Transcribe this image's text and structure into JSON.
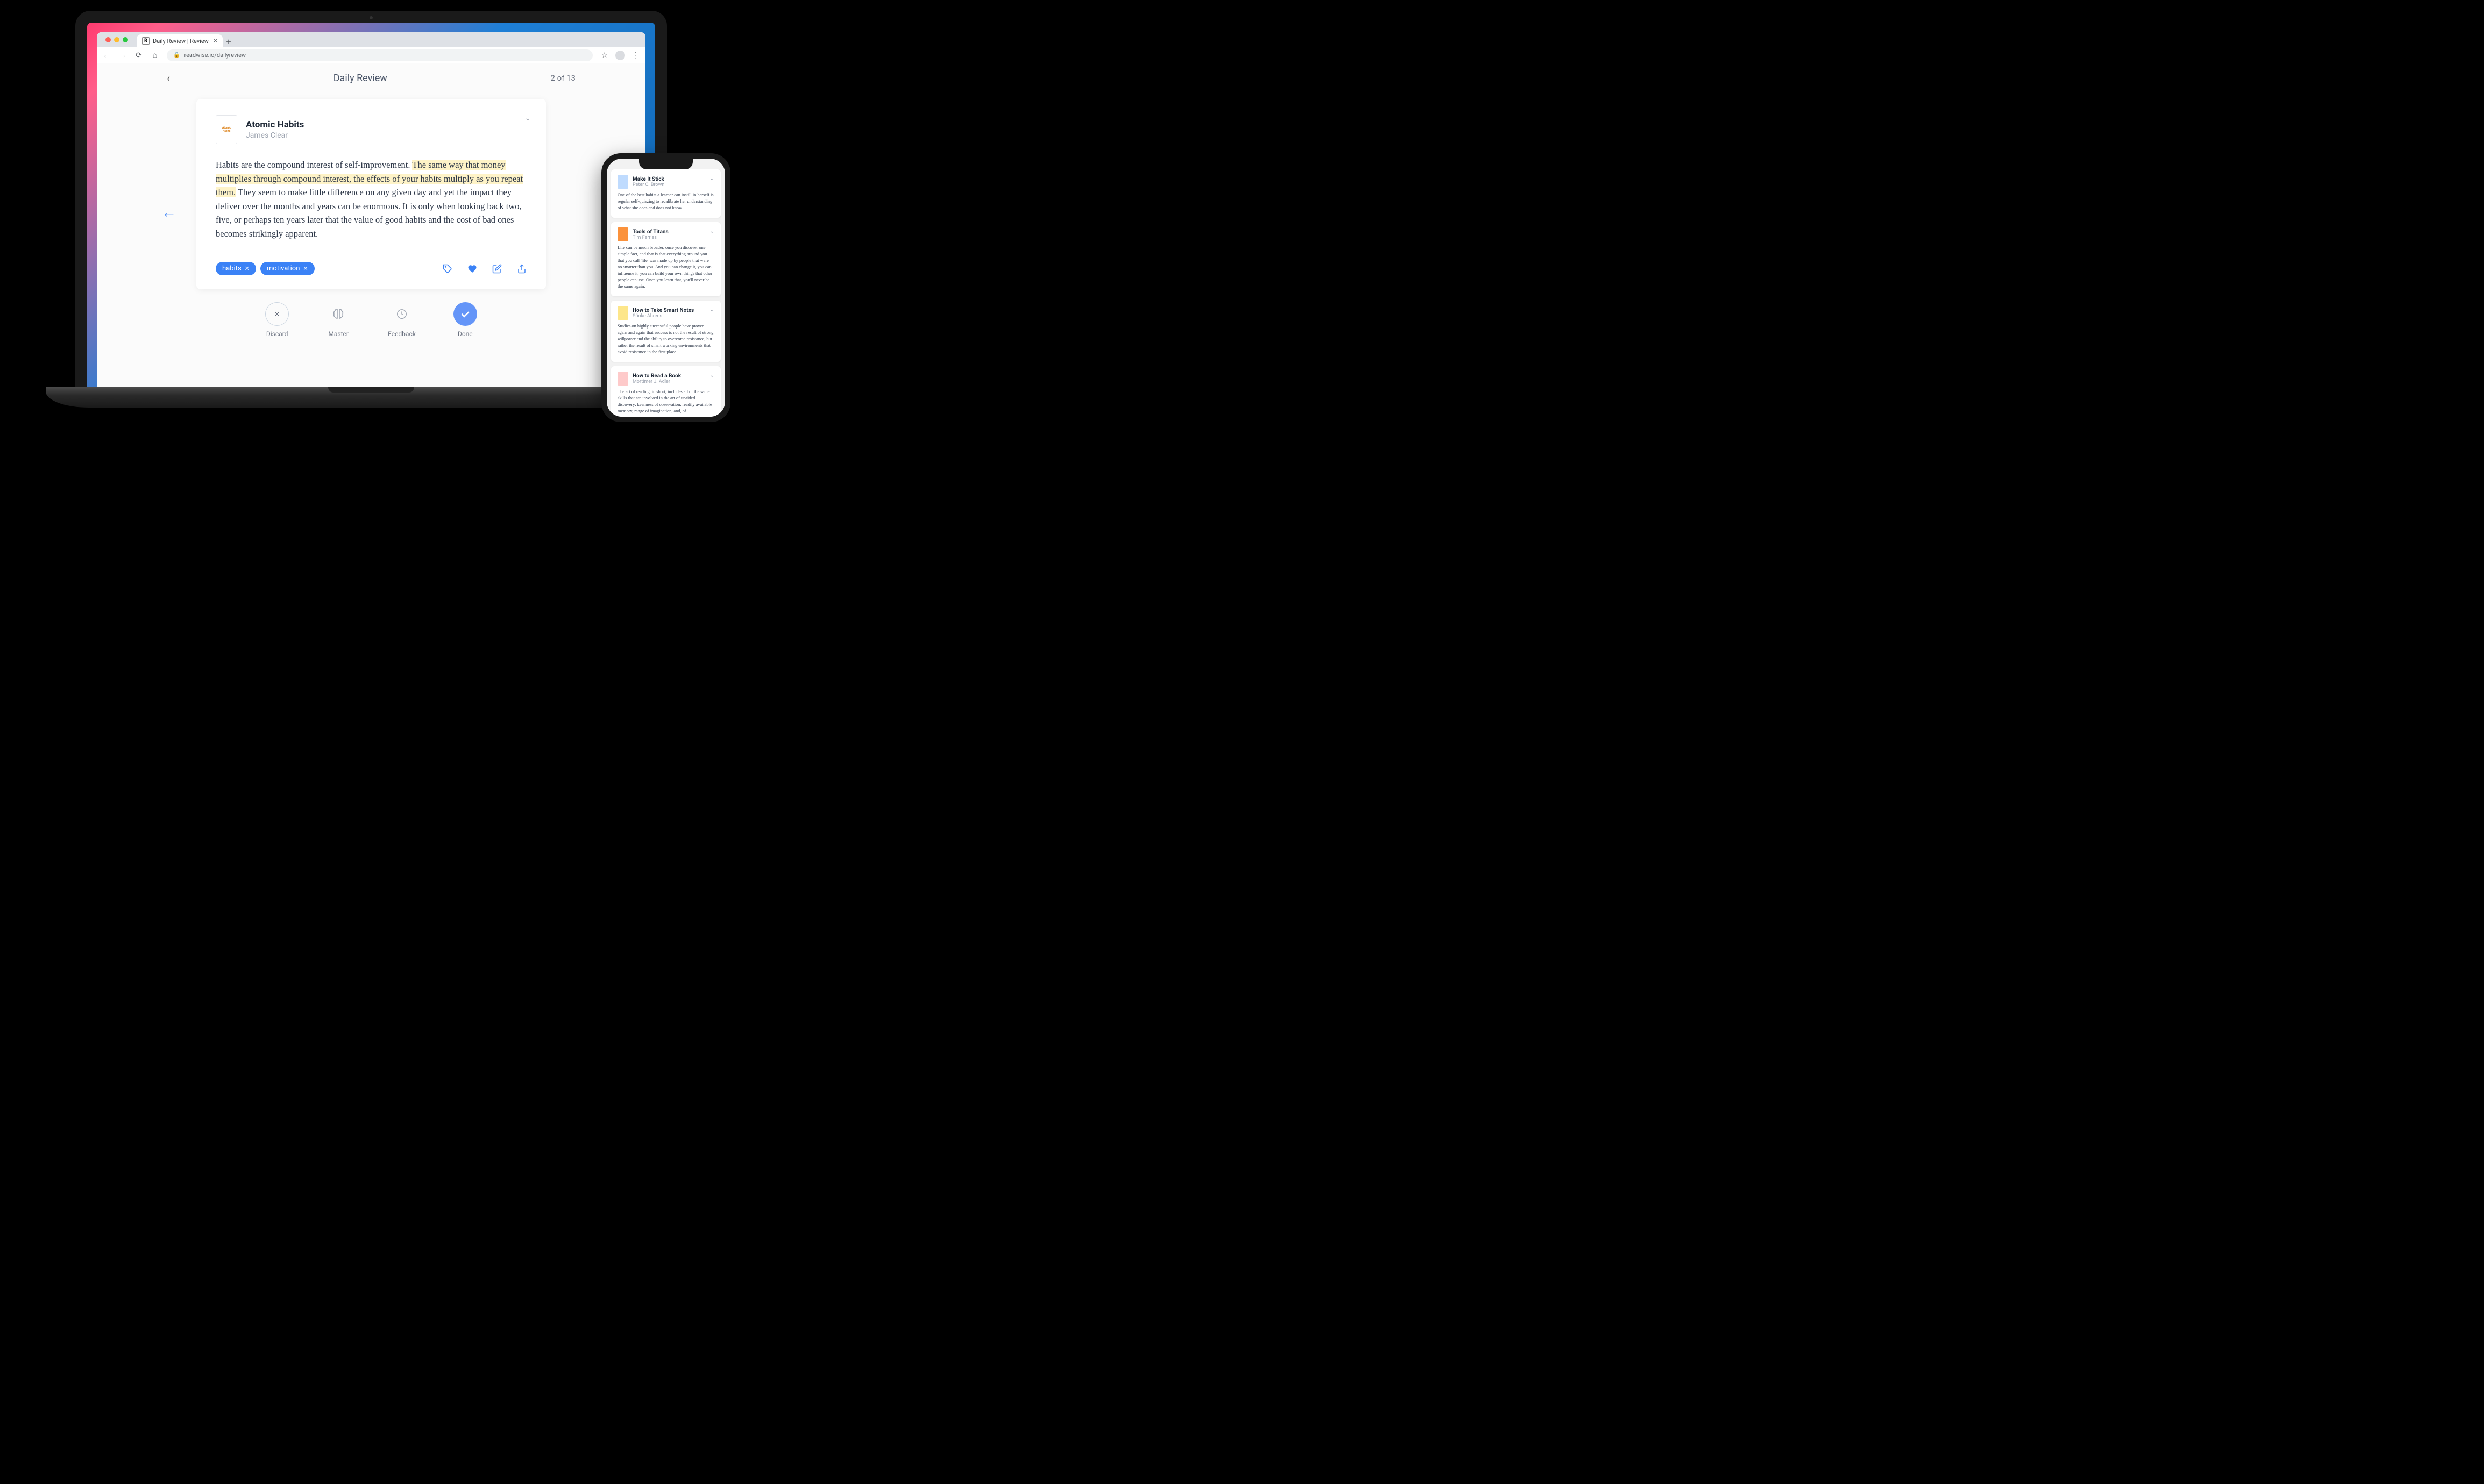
{
  "browser": {
    "tab_title": "Daily Review | Review",
    "url": "readwise.io/dailyreview"
  },
  "app": {
    "header_title": "Daily Review",
    "counter": "2 of 13"
  },
  "highlight": {
    "book_title": "Atomic Habits",
    "author": "James Clear",
    "cover_lines": [
      "Atomic",
      "Habits"
    ],
    "text_before": "Habits are the compound interest of self-improvement. ",
    "text_highlighted": "The same way that money multiplies through compound interest, the effects of your habits multiply as you repeat them.",
    "text_after": " They seem to make little difference on any given day and yet the impact they deliver over the months and years can be enormous. It is only when looking back two, five, or perhaps ten years later that the value of good habits and the cost of bad ones becomes strikingly apparent.",
    "tags": [
      "habits",
      "motivation"
    ]
  },
  "bottom_actions": {
    "discard": "Discard",
    "master": "Master",
    "feedback": "Feedback",
    "done": "Done"
  },
  "phone_cards": [
    {
      "title": "Make It Stick",
      "author": "Peter C. Brown",
      "cover_color": "#bfdbfe",
      "body": "One of the best habits a learner can instill in herself is regular self-quizzing to recalibrate her understanding of what she does and does not know."
    },
    {
      "title": "Tools of Titans",
      "author": "Tim Ferriss",
      "cover_color": "#fb923c",
      "body": "Life can be much broader, once you discover one simple fact, and that is that everything around you that you call 'life' was made up by people that were no smarter than you. And you can change it, you can influence it, you can build your own things that other people can use. Once you learn that, you'll never be the same again."
    },
    {
      "title": "How to Take Smart Notes",
      "author": "Sönke Ahrens",
      "cover_color": "#fde68a",
      "body": "Studies on highly successful people have proven again and again that success is not the result of strong willpower and the ability to overcome resistance, but rather the result of smart working environments that avoid resistance in the first place."
    },
    {
      "title": "How to Read a Book",
      "author": "Mortimer J. Adler",
      "cover_color": "#fecaca",
      "body": "The art of reading, in short, includes all of the same skills that are involved in the art of unaided discovery: keenness of observation, readily available memory, range of imagination, and, of"
    }
  ]
}
